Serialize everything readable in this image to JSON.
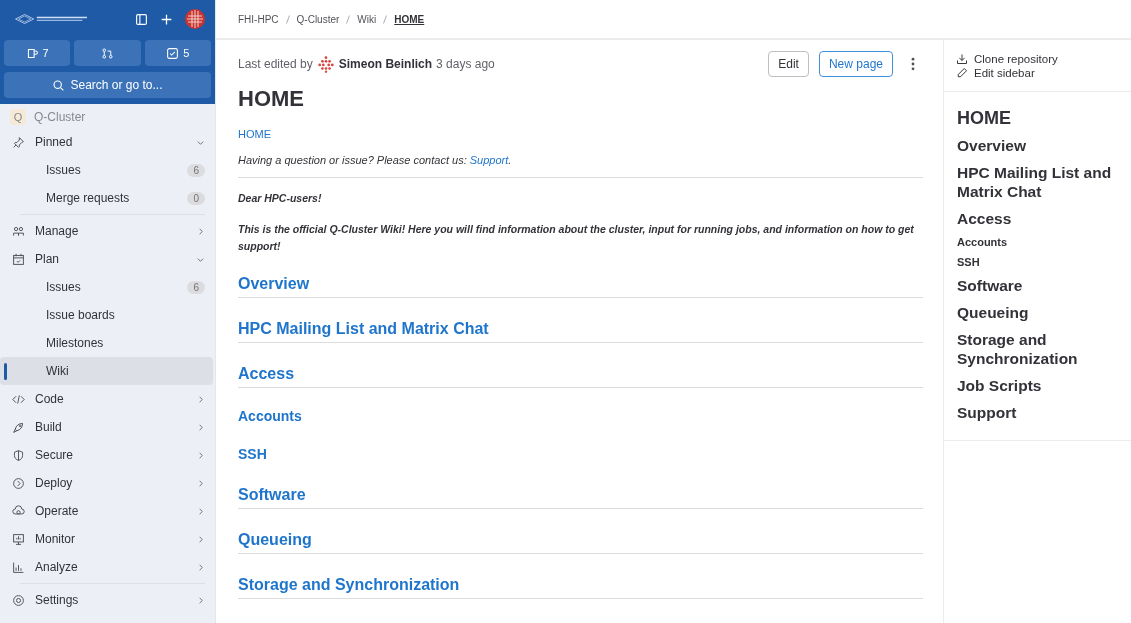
{
  "sidebar": {
    "counters": {
      "issues": "7",
      "todos": "5"
    },
    "search": {
      "placeholder": "Search or go to..."
    },
    "project": {
      "initial": "Q",
      "name": "Q-Cluster"
    },
    "items": [
      {
        "kind": "section",
        "label": "Pinned",
        "expanded": true,
        "selected": false
      },
      {
        "kind": "sub",
        "label": "Issues",
        "count": "6",
        "selected": false
      },
      {
        "kind": "sub",
        "label": "Merge requests",
        "count": "0",
        "selected": false
      },
      {
        "kind": "separator"
      },
      {
        "kind": "section",
        "label": "Manage",
        "expanded": false,
        "selected": false
      },
      {
        "kind": "section",
        "label": "Plan",
        "expanded": true,
        "selected": false
      },
      {
        "kind": "sub",
        "label": "Issues",
        "count": "6",
        "selected": false
      },
      {
        "kind": "sub",
        "label": "Issue boards",
        "selected": false
      },
      {
        "kind": "sub",
        "label": "Milestones",
        "selected": false
      },
      {
        "kind": "sub",
        "label": "Wiki",
        "selected": true
      },
      {
        "kind": "section",
        "label": "Code",
        "expanded": false,
        "selected": false
      },
      {
        "kind": "section",
        "label": "Build",
        "expanded": false,
        "selected": false
      },
      {
        "kind": "section",
        "label": "Secure",
        "expanded": false,
        "selected": false
      },
      {
        "kind": "section",
        "label": "Deploy",
        "expanded": false,
        "selected": false
      },
      {
        "kind": "section",
        "label": "Operate",
        "expanded": false,
        "selected": false
      },
      {
        "kind": "section",
        "label": "Monitor",
        "expanded": false,
        "selected": false
      },
      {
        "kind": "section",
        "label": "Analyze",
        "expanded": false,
        "selected": false
      },
      {
        "kind": "separator"
      },
      {
        "kind": "section",
        "label": "Settings",
        "expanded": false,
        "selected": false
      }
    ]
  },
  "breadcrumb": [
    "FHI-HPC",
    "Q-Cluster",
    "Wiki",
    "HOME"
  ],
  "page": {
    "edited_prefix": "Last edited by",
    "author": "Simeon Beinlich",
    "edited_suffix": "3 days ago",
    "buttons": [
      "Edit",
      "New page"
    ],
    "title": "HOME",
    "link": "HOME",
    "question": "Having a question or issue? Please contact us: ",
    "support_link": "Support",
    "question_end": ".",
    "greeting": "Dear HPC-users!",
    "intro": "This is the official Q-Cluster Wiki! Here you will find information about the cluster, input for running jobs, and information on how to get support!",
    "headings": [
      {
        "kind": "h2",
        "text": "Overview"
      },
      {
        "kind": "h2",
        "text": "HPC Mailing List and Matrix Chat"
      },
      {
        "kind": "h2",
        "text": "Access"
      },
      {
        "kind": "h3",
        "text": "Accounts"
      },
      {
        "kind": "h3",
        "text": "SSH"
      },
      {
        "kind": "h2",
        "text": "Software"
      },
      {
        "kind": "h2",
        "text": "Queueing"
      },
      {
        "kind": "h2",
        "text": "Storage and Synchronization"
      }
    ]
  },
  "right_sidebar": {
    "actions": [
      "Clone repository",
      "Edit sidebar"
    ],
    "toc": [
      {
        "kind": "h1",
        "text": "HOME"
      },
      {
        "kind": "h2",
        "text": "Overview"
      },
      {
        "kind": "h2",
        "text": "HPC Mailing List and Matrix Chat"
      },
      {
        "kind": "h2",
        "text": "Access"
      },
      {
        "kind": "h3",
        "text": "Accounts"
      },
      {
        "kind": "h3",
        "text": "SSH"
      },
      {
        "kind": "h2",
        "text": "Software"
      },
      {
        "kind": "h2",
        "text": "Queueing"
      },
      {
        "kind": "h2",
        "text": "Storage and Synchronization"
      },
      {
        "kind": "h2",
        "text": "Job Scripts"
      },
      {
        "kind": "h2",
        "text": "Support"
      }
    ]
  }
}
